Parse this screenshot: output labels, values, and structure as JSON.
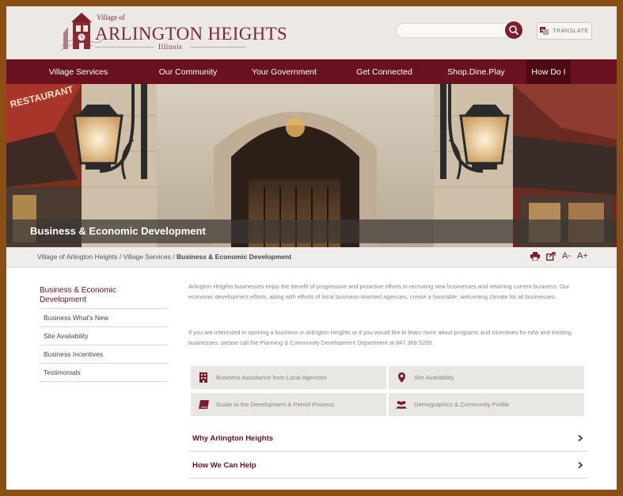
{
  "header": {
    "village_of": "Village of",
    "site_name": "ARLINGTON HEIGHTS",
    "state": "Illinois",
    "search_placeholder": "",
    "translate_label": "TRANSLATE"
  },
  "nav": [
    {
      "label": "Village Services",
      "active": false
    },
    {
      "label": "Our Community",
      "active": false
    },
    {
      "label": "Your Government",
      "active": false
    },
    {
      "label": "Get Connected",
      "active": false
    },
    {
      "label": "Shop.Dine.Play",
      "active": false
    },
    {
      "label": "How Do I",
      "active": true
    }
  ],
  "banner": {
    "title": "Business & Economic Development"
  },
  "breadcrumb": {
    "items": [
      "Village of Arlington Heights",
      "Village Services"
    ],
    "current": "Business & Economic Development",
    "separator": "/"
  },
  "tools": {
    "font_smaller": "A-",
    "font_larger": "A+"
  },
  "sidebar": {
    "title": "Business & Economic Development",
    "items": [
      "Business What's New",
      "Site Availability",
      "Business Incentives",
      "Testimonials"
    ]
  },
  "content": {
    "paragraph_1": "Arlington Heights businesses enjoy the benefit of progressive and proactive efforts in recruiting new businesses and retaining current business. Our economic development efforts, along with efforts of local business-oriented agencies, create a favorable, welcoming climate for all businesses.",
    "paragraph_2": "If you are interested in opening a business in Arlington Heights or if you would like to learn more about programs and incentives for new and existing businesses, please call the Planning & Community Development Department at 847.368.5200.",
    "tiles": [
      {
        "label": "Business Assistance from Local Agencies",
        "icon": "building-icon"
      },
      {
        "label": "Site Availability",
        "icon": "map-pin-icon"
      },
      {
        "label": "Guide to the Development & Permit Process",
        "icon": "book-icon"
      },
      {
        "label": "Demographics & Community Profile",
        "icon": "people-icon"
      }
    ],
    "accordions": [
      {
        "label": "Why Arlington Heights"
      },
      {
        "label": "How We Can Help"
      }
    ]
  },
  "colors": {
    "brand_maroon": "#6a1120",
    "nav_active": "#4d0914",
    "frame": "#8a4f12"
  }
}
